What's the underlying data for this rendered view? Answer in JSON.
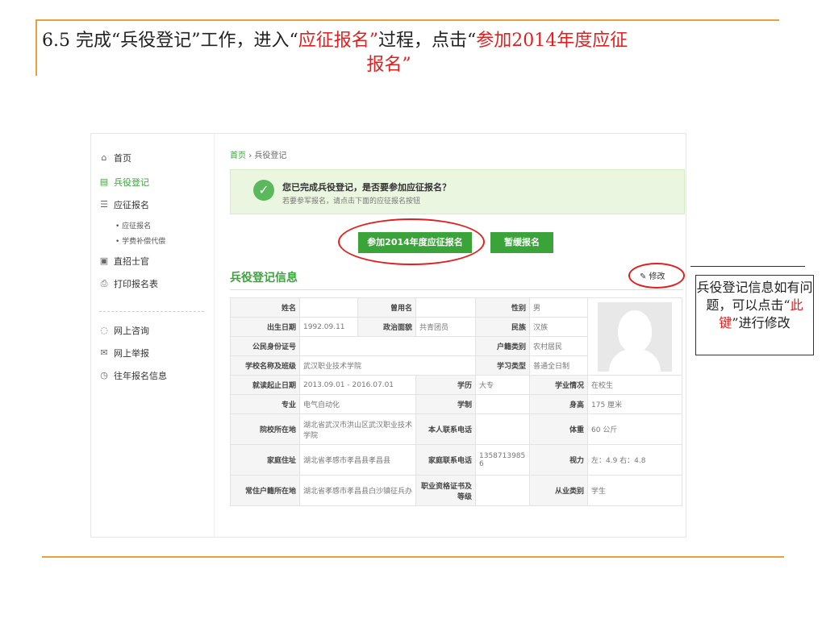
{
  "title": {
    "p1": "6.5 完成“兵役登记”工作，进入“",
    "p2": "应征报名”",
    "p3": "过程，点击“",
    "p4": "参加2014年度应征",
    "line2": "报名”"
  },
  "sidebar": {
    "items": [
      {
        "label": "首页",
        "icon": "home-icon"
      },
      {
        "label": "兵役登记",
        "icon": "clipboard-icon"
      },
      {
        "label": "应征报名",
        "icon": "form-icon"
      },
      {
        "label": "直招士官",
        "icon": "id-card-icon"
      },
      {
        "label": "打印报名表",
        "icon": "printer-icon"
      },
      {
        "label": "网上咨询",
        "icon": "chat-icon"
      },
      {
        "label": "网上举报",
        "icon": "mail-icon"
      },
      {
        "label": "往年报名信息",
        "icon": "history-icon"
      }
    ],
    "subitems": [
      "• 应征报名",
      "• 学费补偿代偿"
    ]
  },
  "breadcrumb": {
    "home": "首页",
    "sep": "›",
    "current": "兵役登记"
  },
  "notice": {
    "title": "您已完成兵役登记，是否要参加应征报名？",
    "subtitle": "若要参军报名，请点击下面的应征报名按钮"
  },
  "buttons": {
    "join": "参加2014年度应征报名",
    "defer": "暂缓报名"
  },
  "section": {
    "title": "兵役登记信息",
    "edit": "✎ 修改"
  },
  "table": {
    "name_l": "姓名",
    "name_v": "",
    "former_l": "曾用名",
    "former_v": "",
    "gender_l": "性别",
    "gender_v": "男",
    "birth_l": "出生日期",
    "birth_v": "1992.09.11",
    "political_l": "政治面貌",
    "political_v": "共青团员",
    "ethnic_l": "民族",
    "ethnic_v": "汉族",
    "idno_l": "公民身份证号",
    "idno_v": "",
    "hukou_type_l": "户籍类别",
    "hukou_type_v": "农村居民",
    "school_l": "学校名称及班级",
    "school_v": "武汉职业技术学院",
    "study_type_l": "学习类型",
    "study_type_v": "普通全日制",
    "period_l": "就读起止日期",
    "period_v": "2013.09.01 - 2016.07.01",
    "edu_l": "学历",
    "edu_v": "大专",
    "status_l": "学业情况",
    "status_v": "在校生",
    "major_l": "专业",
    "major_v": "电气自动化",
    "length_l": "学制",
    "length_v": "",
    "height_l": "身高",
    "height_v": "175 厘米",
    "school_addr_l": "院校所在地",
    "school_addr_v": "湖北省武汉市洪山区武汉职业技术学院",
    "phone_l": "本人联系电话",
    "phone_v": "",
    "weight_l": "体重",
    "weight_v": "60 公斤",
    "home_addr_l": "家庭住址",
    "home_addr_v": "湖北省孝感市孝昌县孝昌县",
    "home_phone_l": "家庭联系电话",
    "home_phone_v": "13587139856",
    "vision_l": "视力",
    "vision_v": "左：4.9 右：4.8",
    "residence_l": "常住户籍所在地",
    "residence_v": "湖北省孝感市孝昌县白沙镇征兵办",
    "cert_l": "职业资格证书及等级",
    "cert_v": "",
    "occupation_l": "从业类别",
    "occupation_v": "学生"
  },
  "callout": {
    "p1": "兵役登记信息如有问题，可以点击“",
    "p2": "此键",
    "p3": "”进行修改"
  }
}
